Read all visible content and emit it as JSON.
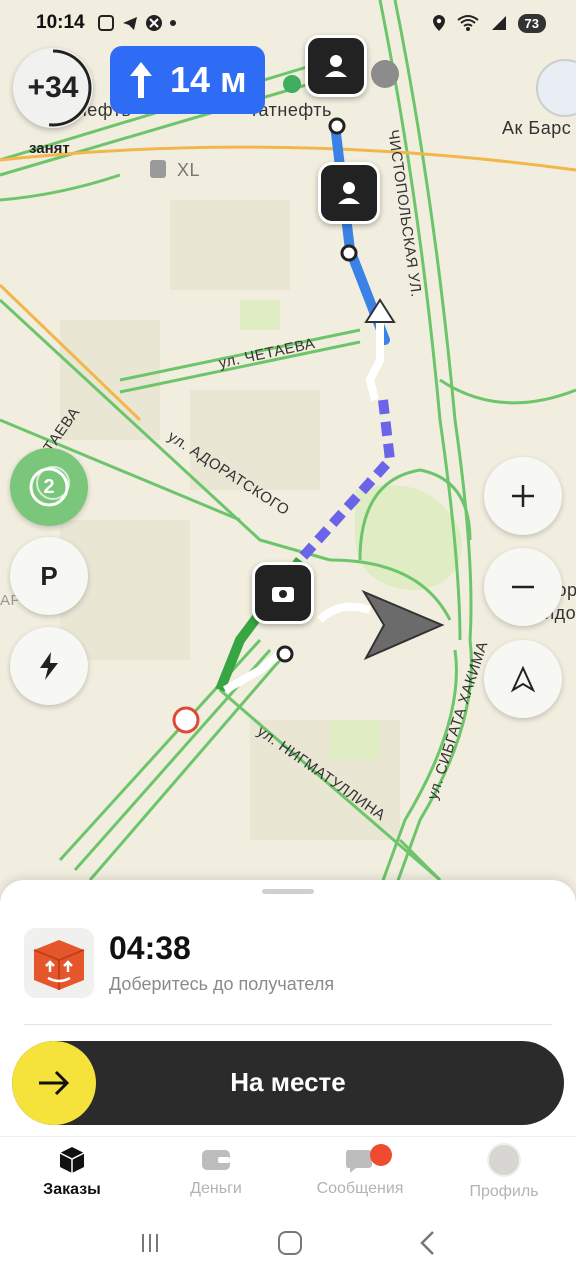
{
  "status_bar": {
    "time": "10:14",
    "battery": "73"
  },
  "busy_indicator": {
    "value": "+34",
    "label": "занят"
  },
  "maneuver": {
    "distance": "14 м"
  },
  "map": {
    "labels": {
      "tatneft_1": "атнефть",
      "tatneft_2": "татнефть",
      "ak_bars": "Ак Барс",
      "xl": "XL",
      "chetaeva_1": "ул. ЧЕТАЕВА",
      "chetaeva_2": "ЧЕТАЕВА",
      "adoratskogo": "ул. АДОРАТСКОГО",
      "chistopolskaya": "ЧИСТОПОЛЬСКАЯ УЛ.",
      "nigmatullina": "ул. НИГМАТУЛЛИНА",
      "sibgata": "ул. СИБГАТА ХАКИМА",
      "kvartal": "АРТАЛ",
      "dvorets_1": "Двор",
      "dvorets_2": "видо"
    },
    "layers_count": "2",
    "parking_label": "P"
  },
  "order": {
    "eta": "04:38",
    "subtitle": "Доберитесь до получателя"
  },
  "slider": {
    "label": "На месте"
  },
  "tabs": [
    {
      "label": "Заказы",
      "active": true
    },
    {
      "label": "Деньги",
      "active": false
    },
    {
      "label": "Сообщения",
      "active": false
    },
    {
      "label": "Профиль",
      "active": false
    }
  ],
  "colors": {
    "route_blue": "#3b82e6",
    "route_dashed": "#6b63e8",
    "accent_yellow": "#f5e23b",
    "maneuver_blue": "#2f6cf6"
  }
}
